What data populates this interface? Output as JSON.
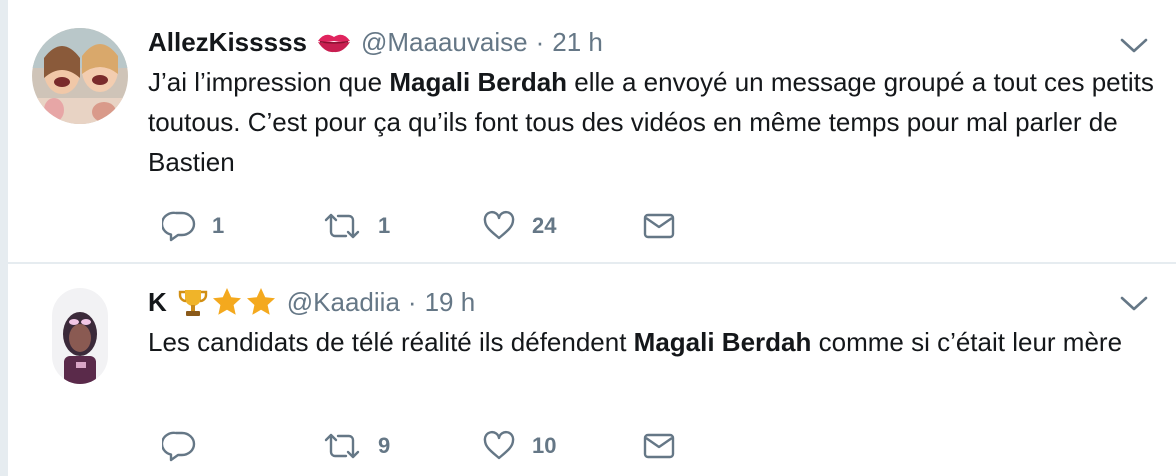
{
  "tweets": [
    {
      "display_name": "AllezKisssss",
      "name_emoji": "💋",
      "handle": "@Maaauvaise",
      "dot": "·",
      "time": "21 h",
      "text_before": "J’ai l’impression que ",
      "text_bold": "Magali Berdah",
      "text_after": " elle a envoyé un message groupé a tout ces petits toutous. C’est pour ça qu’ils font tous des vidéos en même temps pour mal parler de Bastien",
      "replies": "1",
      "retweets": "1",
      "likes": "24"
    },
    {
      "display_name": "K",
      "name_emoji": "🏆⭐⭐",
      "handle": "@Kaadiia",
      "dot": "·",
      "time": "19 h",
      "text_before": "Les candidats de télé réalité ils défendent ",
      "text_bold": "Magali Berdah",
      "text_after": " comme si c’était leur mère",
      "replies": "",
      "retweets": "9",
      "likes": "10"
    }
  ],
  "colors": {
    "text": "#14171a",
    "muted": "#657786",
    "icon": "#657786",
    "divider": "#e6ecf0",
    "lips": "#e0245e",
    "trophy": "#c98a1a",
    "star": "#f4a91e"
  },
  "icons": {
    "reply": "reply-icon",
    "retweet": "retweet-icon",
    "like": "heart-icon",
    "dm": "envelope-icon",
    "more": "chevron-down-icon"
  }
}
